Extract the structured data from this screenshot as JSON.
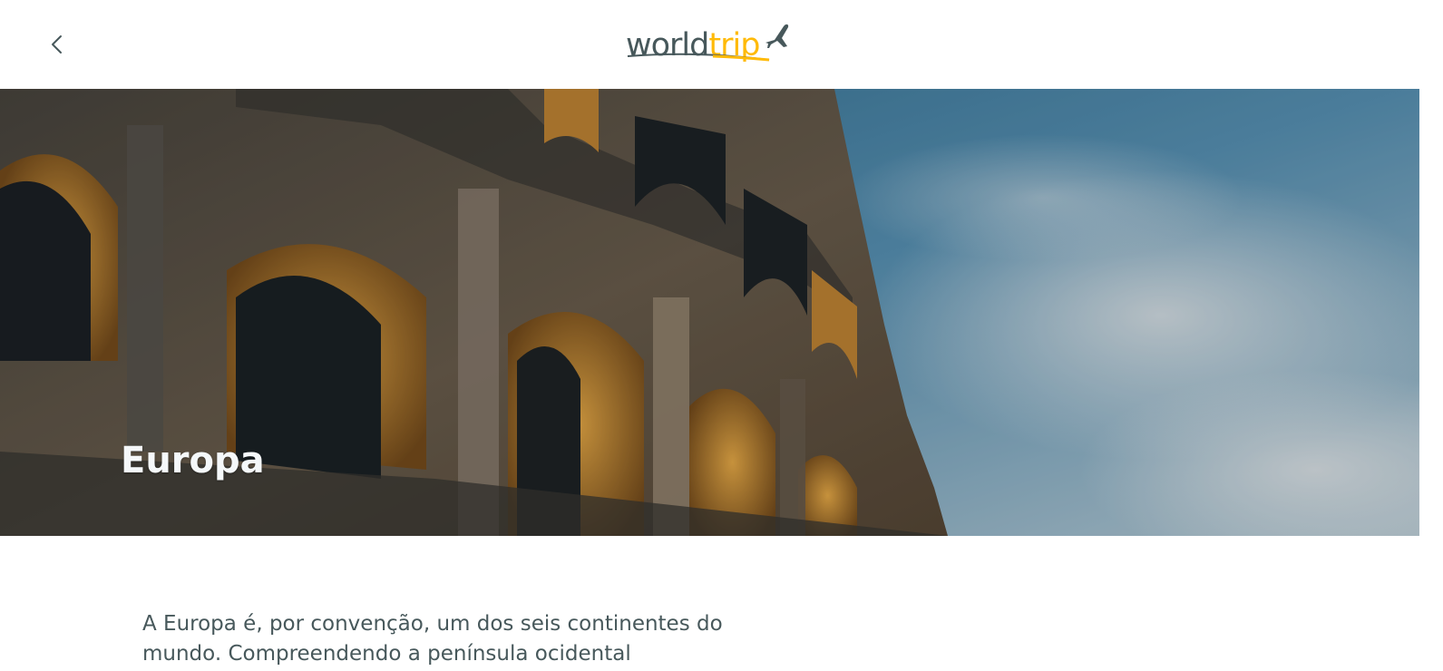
{
  "header": {
    "back_icon": "chevron-left-icon",
    "logo": {
      "part1": "world",
      "part2": "trip",
      "icon": "airplane-icon",
      "colors": {
        "primary": "#47585B",
        "accent": "#FFBA08"
      }
    }
  },
  "banner": {
    "title": "Europa",
    "image": "colosseum-photo"
  },
  "content": {
    "description": "A Europa é, por convenção, um dos seis continentes do mundo. Compreendendo a península ocidental"
  }
}
